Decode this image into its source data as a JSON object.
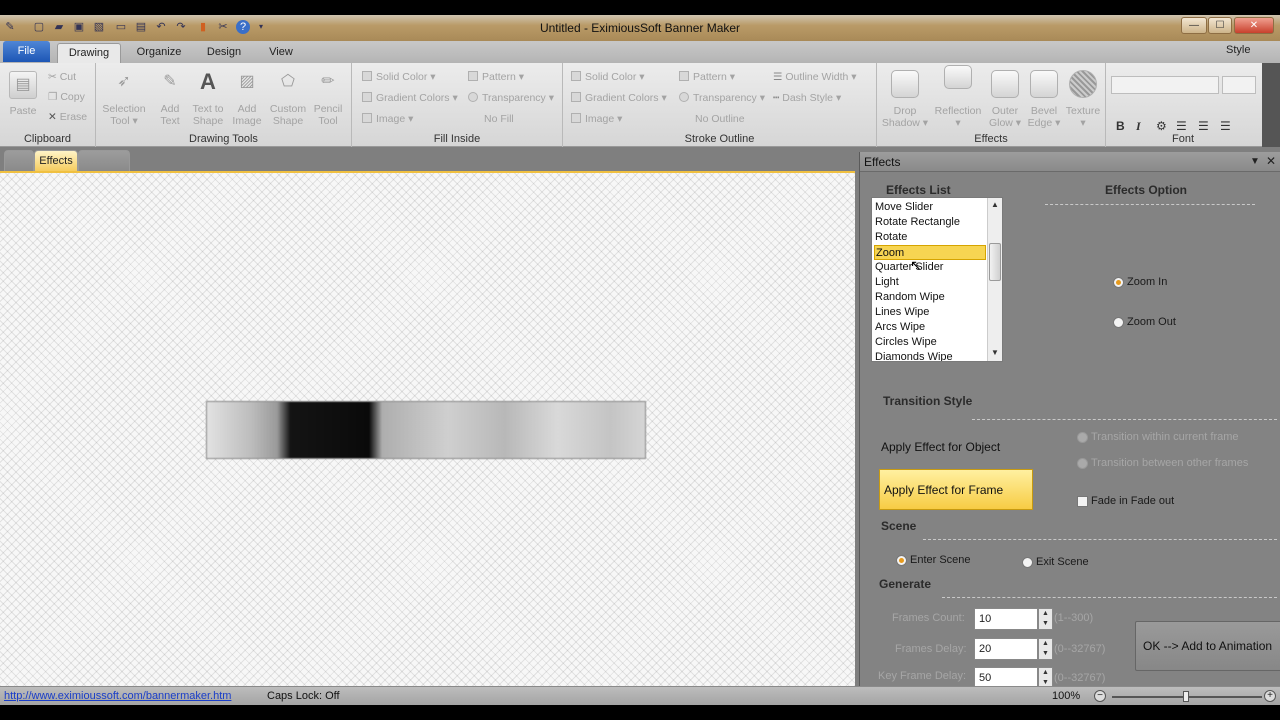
{
  "window": {
    "title": "Untitled - EximiousSoft Banner Maker",
    "controls": {
      "minimize": "—",
      "maximize": "☐",
      "close": "✕"
    }
  },
  "ribbon_tabs": {
    "file": "File",
    "tabs": [
      "Drawing",
      "Organize",
      "Design",
      "View"
    ],
    "active": "Drawing",
    "style": "Style"
  },
  "ribbon": {
    "clipboard": {
      "label": "Clipboard",
      "paste": "Paste",
      "cut": "Cut",
      "copy": "Copy",
      "erase": "Erase"
    },
    "drawing_tools": {
      "label": "Drawing Tools",
      "buttons": [
        {
          "line1": "Selection",
          "line2": "Tool ▾"
        },
        {
          "line1": "Add",
          "line2": "Text"
        },
        {
          "line1": "Text to",
          "line2": "Shape"
        },
        {
          "line1": "Add",
          "line2": "Image"
        },
        {
          "line1": "Custom",
          "line2": "Shape"
        },
        {
          "line1": "Pencil",
          "line2": "Tool"
        }
      ]
    },
    "fill_inside": {
      "label": "Fill Inside",
      "solid_color": "Solid Color ▾",
      "gradient_colors": "Gradient Colors ▾",
      "image": "Image ▾",
      "pattern": "Pattern ▾",
      "transparency": "Transparency ▾",
      "no_fill": "No Fill"
    },
    "stroke_outline": {
      "label": "Stroke Outline",
      "solid_color": "Solid Color ▾",
      "gradient_colors": "Gradient Colors ▾",
      "image": "Image ▾",
      "pattern": "Pattern ▾",
      "transparency": "Transparency ▾",
      "no_outline": "No Outline",
      "outline_width": "Outline Width ▾",
      "dash_style": "Dash Style ▾"
    },
    "effects": {
      "label": "Effects",
      "buttons": [
        {
          "line1": "Drop",
          "line2": "Shadow ▾"
        },
        {
          "line1": "Reflection",
          "line2": "▾"
        },
        {
          "line1": "Outer",
          "line2": "Glow ▾"
        },
        {
          "line1": "Bevel",
          "line2": "Edge ▾"
        },
        {
          "line1": "Texture",
          "line2": "▾"
        }
      ]
    },
    "font": {
      "label": "Font",
      "bold": "B",
      "italic": "I"
    }
  },
  "doc_tabs": {
    "active": "Effects"
  },
  "panel": {
    "title": "Effects",
    "effects_list_heading": "Effects List",
    "effects_option_heading": "Effects Option",
    "effects_list": [
      "Move Slider",
      "Rotate Rectangle",
      "Rotate",
      "Zoom",
      "Quarter Slider",
      "Light",
      "Random Wipe",
      "Lines Wipe",
      "Arcs Wipe",
      "Circles Wipe",
      "Diamonds Wipe"
    ],
    "selected_effect": "Zoom",
    "zoom_in": "Zoom In",
    "zoom_out": "Zoom Out",
    "transition_style_heading": "Transition Style",
    "apply_object": "Apply Effect for Object",
    "apply_frame": "Apply Effect  for Frame",
    "transition_current": "Transition within current frame",
    "transition_other": "Transition between other frames",
    "fade": "Fade in Fade out",
    "scene_heading": "Scene",
    "enter_scene": "Enter Scene",
    "exit_scene": "Exit Scene",
    "generate_heading": "Generate",
    "frames_count_label": "Frames Count:",
    "frames_count_value": "10",
    "frames_count_range": "(1--300)",
    "frames_delay_label": "Frames Delay:",
    "frames_delay_value": "20",
    "frames_delay_range": "(0--32767)",
    "key_frame_delay_label": "Key Frame Delay:",
    "key_frame_delay_value": "50",
    "key_frame_delay_range": "(0--32767)",
    "ok_button": "OK --> Add to Animation"
  },
  "status": {
    "url": "http://www.eximioussoft.com/bannermaker.htm",
    "caps": "Caps Lock: Off",
    "zoom": "100%"
  },
  "colors": {
    "accent": "#f7cc44",
    "selection": "#f7d552",
    "file_tab": "#1d56b5"
  }
}
